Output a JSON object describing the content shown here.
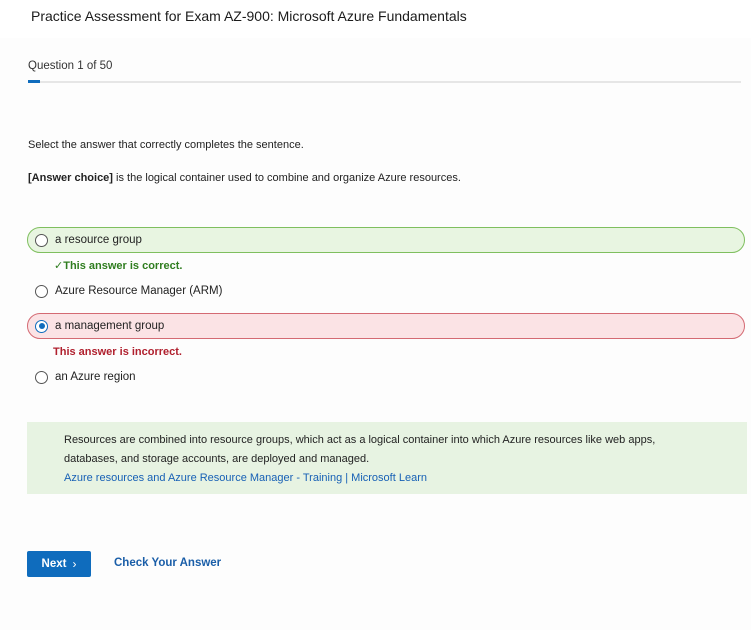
{
  "header": {
    "title": "Practice Assessment for Exam AZ-900: Microsoft Azure Fundamentals"
  },
  "progress": {
    "label": "Question 1 of 50",
    "current": 1,
    "total": 50
  },
  "question": {
    "instruction": "Select the answer that correctly completes the sentence.",
    "placeholder": "[Answer choice]",
    "text": " is the logical container used to combine and organize Azure resources."
  },
  "options": [
    {
      "label": "a resource group",
      "state": "correct",
      "selected": false
    },
    {
      "label": "Azure Resource Manager (ARM)",
      "state": "none",
      "selected": false
    },
    {
      "label": "a management group",
      "state": "incorrect",
      "selected": true
    },
    {
      "label": "an Azure region",
      "state": "none",
      "selected": false
    }
  ],
  "feedback": {
    "correct": "This answer is correct.",
    "incorrect": "This answer is incorrect."
  },
  "explanation": {
    "text": "Resources are combined into resource groups, which act as a logical container into which Azure resources like web apps, databases, and storage accounts, are deployed and managed.",
    "link": "Azure resources and Azure Resource Manager - Training | Microsoft Learn"
  },
  "actions": {
    "next_label": "Next",
    "next_icon": "chevron-right-icon",
    "check_label": "Check Your Answer"
  },
  "colors": {
    "accent": "#0f6cbd",
    "correct_bg": "#e8f5e1",
    "correct_border": "#7fbf5f",
    "incorrect_bg": "#fbe3e5",
    "incorrect_border": "#d46a73"
  }
}
